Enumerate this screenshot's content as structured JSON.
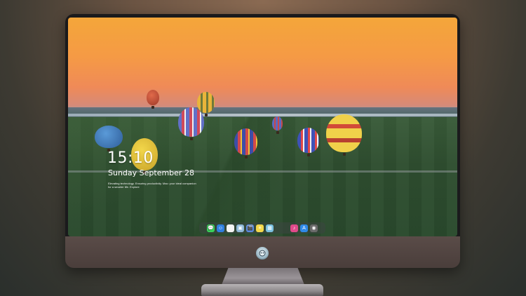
{
  "lockscreen": {
    "time": "15:10",
    "date": "Sunday September 28",
    "tagline": "Elevating technology. Ensuring productivity. Mac: your ideal companion for a smarter life. Explore"
  },
  "dock": {
    "items": [
      {
        "name": "messages-icon",
        "glyph": "💬",
        "color": "#3ad15a"
      },
      {
        "name": "finder-icon",
        "glyph": "☺",
        "color": "#2f7fe0"
      },
      {
        "name": "clock-icon",
        "glyph": "◷",
        "color": "#f2f2f2"
      },
      {
        "name": "preview-icon",
        "glyph": "▣",
        "color": "#8fb8d8"
      },
      {
        "name": "clapper-icon",
        "glyph": "🎬",
        "color": "#5a8ae0"
      },
      {
        "name": "notes-icon",
        "glyph": "≡",
        "color": "#f4d84a"
      },
      {
        "name": "photos-icon",
        "glyph": "▦",
        "color": "#7ac0e0"
      },
      {
        "name": "music-icon",
        "glyph": "♪",
        "color": "#e04a8a"
      },
      {
        "name": "appstore-icon",
        "glyph": "A",
        "color": "#2f8ae8"
      },
      {
        "name": "camera-icon",
        "glyph": "◉",
        "color": "#6a6a6a"
      }
    ]
  },
  "colors": {
    "sky_top": "#f4a63a",
    "bezel": "#1a1a1c",
    "chin": "#5a4c48"
  }
}
